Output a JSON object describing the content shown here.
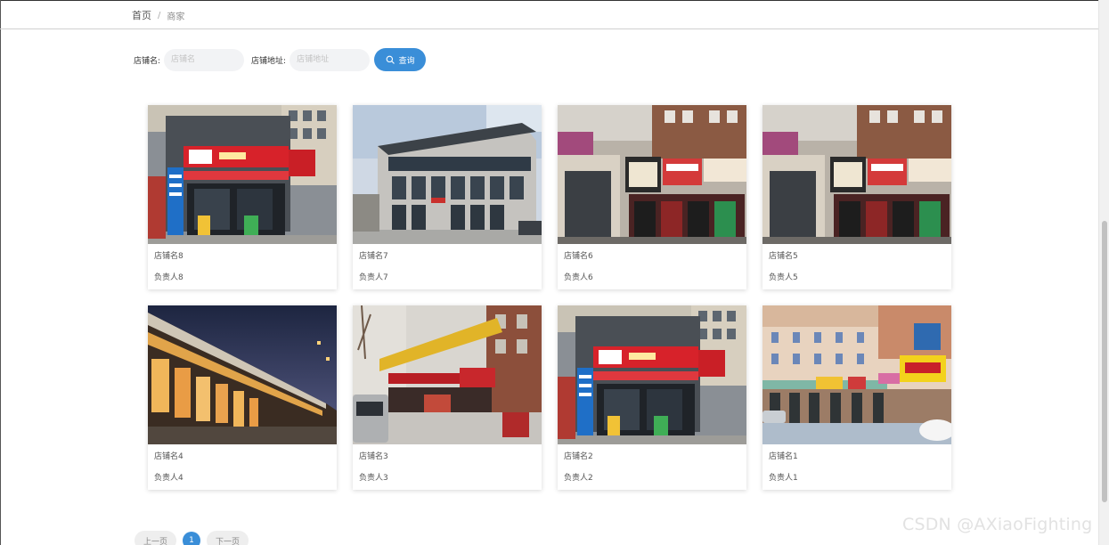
{
  "breadcrumb": {
    "home": "首页",
    "separator": "/",
    "current": "商家"
  },
  "search": {
    "shop_name_label": "店铺名:",
    "shop_name_placeholder": "店铺名",
    "address_label": "店铺地址:",
    "address_placeholder": "店铺地址",
    "button_label": "查询",
    "button_icon": "search-icon"
  },
  "shops": [
    {
      "name": "店铺名8",
      "owner": "负责人8",
      "photo": "convenience-store"
    },
    {
      "name": "店铺名7",
      "owner": "负责人7",
      "photo": "office-building"
    },
    {
      "name": "店铺名6",
      "owner": "负责人6",
      "photo": "street-shops"
    },
    {
      "name": "店铺名5",
      "owner": "负责人5",
      "photo": "street-shops"
    },
    {
      "name": "店铺名4",
      "owner": "负责人4",
      "photo": "night-mall"
    },
    {
      "name": "店铺名3",
      "owner": "负责人3",
      "photo": "street-corner"
    },
    {
      "name": "店铺名2",
      "owner": "负责人2",
      "photo": "convenience-store"
    },
    {
      "name": "店铺名1",
      "owner": "负责人1",
      "photo": "pastel-street"
    }
  ],
  "pagination": {
    "prev_label": "上一页",
    "current_page": "1",
    "next_label": "下一页"
  },
  "watermark": "CSDN @AXiaoFighting",
  "colors": {
    "accent": "#3a8ed8",
    "input_bg": "#f2f3f5"
  }
}
